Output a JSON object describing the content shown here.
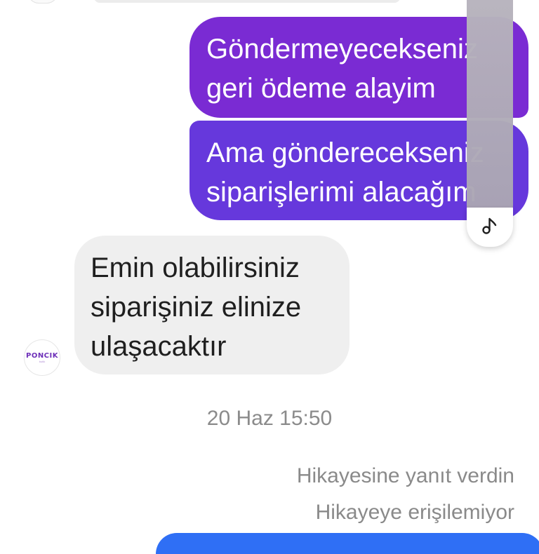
{
  "messages": {
    "outgoing_1": "Göndermeyecekseniz\ngeri ödeme alayim",
    "outgoing_2": "Ama gönderecekseniz\nsiparişlerimi alacağım",
    "incoming_1": "Emin olabilirsiniz\nsiparişiniz elinize\nulaşacaktır"
  },
  "timestamp": "20 Haz 15:50",
  "story_reply": {
    "action_text": "Hikayesine yanıt verdin",
    "unavailable_text": "Hikayeye erişilemiyor"
  },
  "avatar": {
    "logo_text": "PONCIK",
    "sub_text": "butik"
  },
  "icons": {
    "music": "music-note-icon"
  },
  "colors": {
    "outgoing_top": "#7a2bd3",
    "outgoing_bottom": "#6638dc",
    "incoming": "#efefef",
    "outgoing_next": "#2f6ff5",
    "meta_text": "#8a8a8a"
  }
}
